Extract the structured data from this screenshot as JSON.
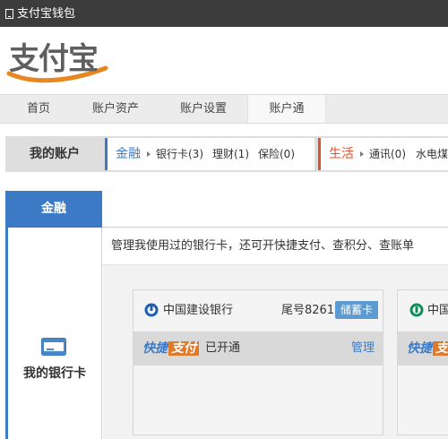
{
  "window": {
    "title": "支付宝钱包"
  },
  "brand": {
    "logo_text": "支付宝"
  },
  "nav": {
    "items": [
      "首页",
      "账户资产",
      "账户设置",
      "账户通"
    ],
    "active": "账户通"
  },
  "account": {
    "label": "我的账户",
    "finance": {
      "label": "金融",
      "items": [
        "银行卡(3)",
        "理财(1)",
        "保险(0)"
      ]
    },
    "life": {
      "label": "生活",
      "items": [
        "通讯(0)",
        "水电煤"
      ]
    }
  },
  "sidebar": {
    "active_section": "金融",
    "card_section_label": "我的银行卡"
  },
  "main": {
    "description": "管理我使用过的银行卡，还可开快捷支付、查积分、查账单",
    "cards": [
      {
        "bank": "中国建设银行",
        "tail": "尾号8261",
        "type": "储蓄卡",
        "quick_pay_logo_a": "快捷",
        "quick_pay_logo_b": "支付",
        "status": "已开通",
        "action": "管理"
      },
      {
        "bank": "中国",
        "quick_pay_logo_a": "快捷",
        "quick_pay_logo_b": "支"
      }
    ]
  },
  "colors": {
    "accent_blue": "#3d7ac6",
    "life_orange": "#e0502a",
    "quick_orange": "#e07a2a",
    "badge_blue": "#5b9bd1"
  }
}
